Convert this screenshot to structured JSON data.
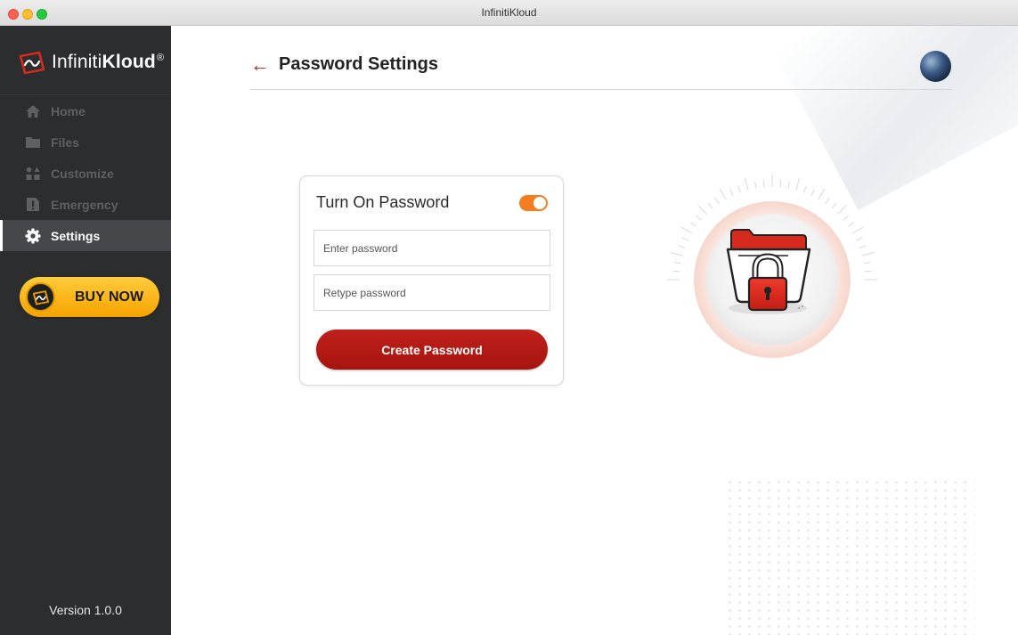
{
  "window": {
    "title": "InfinitiKloud"
  },
  "sidebar": {
    "logo": {
      "brand_light": "Infiniti",
      "brand_bold": "Kloud",
      "registered": "®"
    },
    "items": [
      {
        "label": "Home",
        "icon": "home-icon",
        "active": false
      },
      {
        "label": "Files",
        "icon": "folder-icon",
        "active": false
      },
      {
        "label": "Customize",
        "icon": "customize-icon",
        "active": false
      },
      {
        "label": "Emergency",
        "icon": "emergency-icon",
        "active": false
      },
      {
        "label": "Settings",
        "icon": "gear-icon",
        "active": true
      }
    ],
    "buy_now": "BUY NOW",
    "version": "Version 1.0.0"
  },
  "header": {
    "title": "Password Settings"
  },
  "password_card": {
    "title": "Turn On Password",
    "toggle_on": true,
    "password_placeholder": "Enter password",
    "retype_placeholder": "Retype password",
    "create_button": "Create Password"
  },
  "colors": {
    "sidebar_bg": "#2b2d2f",
    "accent_red": "#b51f1a",
    "toggle_orange": "#f47d20",
    "buy_yellow": "#fbb914"
  }
}
